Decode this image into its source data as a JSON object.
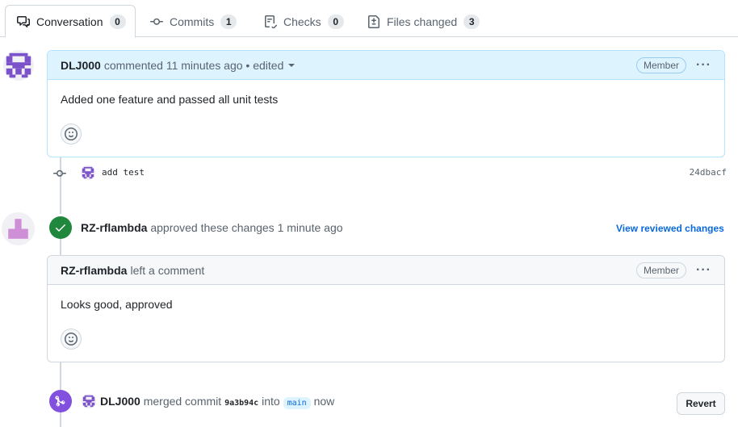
{
  "tabs": [
    {
      "label": "Conversation",
      "count": "0",
      "icon": "conversation-icon",
      "active": true
    },
    {
      "label": "Commits",
      "count": "1",
      "icon": "commit-icon",
      "active": false
    },
    {
      "label": "Checks",
      "count": "0",
      "icon": "checklist-icon",
      "active": false
    },
    {
      "label": "Files changed",
      "count": "3",
      "icon": "file-diff-icon",
      "active": false
    }
  ],
  "first_comment": {
    "author": "DLJ000",
    "meta": "commented 11 minutes ago • edited",
    "role": "Member",
    "more": "···",
    "body": "Added one feature and passed all unit tests"
  },
  "commit": {
    "message": "add test",
    "sha": "24dbacf"
  },
  "review": {
    "author": "RZ-rflambda",
    "text": "approved these changes 1 minute ago",
    "link": "View reviewed changes",
    "status_color": "#1f883d"
  },
  "review_comment": {
    "author": "RZ-rflambda",
    "meta": "left a comment",
    "role": "Member",
    "more": "···",
    "body": "Looks good, approved"
  },
  "merge": {
    "author": "DLJ000",
    "text_before": "merged commit",
    "sha": "9a3b94c",
    "text_into": "into",
    "branch": "main",
    "text_after": "now",
    "button": "Revert",
    "status_color": "#8250df"
  }
}
